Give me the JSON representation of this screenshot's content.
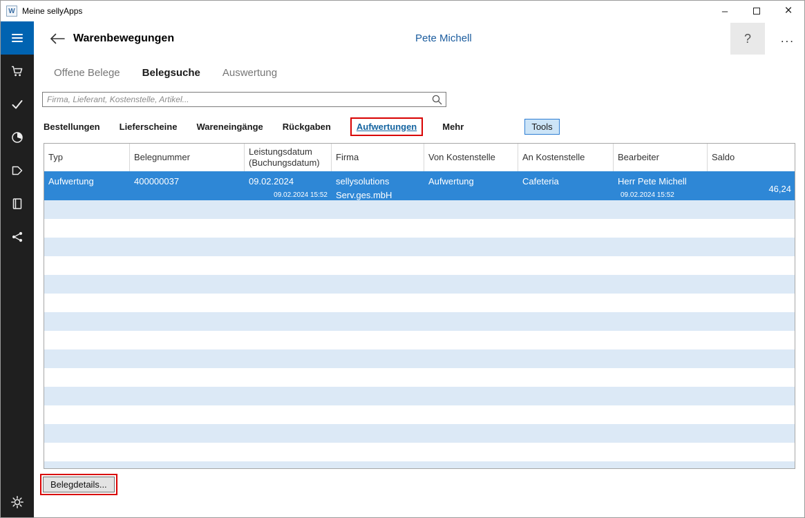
{
  "titlebar": {
    "app_icon_letter": "W",
    "title": "Meine sellyApps",
    "minimize_label": "–",
    "close_label": "×"
  },
  "sidebar": {
    "icons": [
      "menu",
      "cart",
      "checkmark",
      "pie-chart",
      "tag",
      "book",
      "share",
      "gear"
    ]
  },
  "header": {
    "title": "Warenbewegungen",
    "user": "Pete Michell",
    "help_label": "?",
    "more_label": "..."
  },
  "view_tabs": {
    "items": [
      "Offene Belege",
      "Belegsuche",
      "Auswertung"
    ],
    "active": "Belegsuche"
  },
  "search": {
    "placeholder": "Firma, Lieferant, Kostenstelle, Artikel..."
  },
  "filters": {
    "items": [
      "Bestellungen",
      "Lieferscheine",
      "Wareneingänge",
      "Rückgaben",
      "Aufwertungen",
      "Mehr"
    ],
    "active": "Aufwertungen",
    "tools_label": "Tools"
  },
  "table": {
    "columns": [
      "Typ",
      "Belegnummer",
      "Leistungsdatum (Buchungsdatum)",
      "Firma",
      "Von Kostenstelle",
      "An Kostenstelle",
      "Bearbeiter",
      "Saldo"
    ],
    "rows": [
      {
        "typ": "Aufwertung",
        "belegnummer": "400000037",
        "leistungsdatum": "09.02.2024",
        "buchungsdatum": "09.02.2024 15:52",
        "firma": "sellysolutions Serv.ges.mbH",
        "von_kostenstelle": "Aufwertung",
        "an_kostenstelle": "Cafeteria",
        "bearbeiter": "Herr Pete Michell",
        "bearbeiter_datum": "09.02.2024 15:52",
        "saldo": "46,24"
      }
    ]
  },
  "footer": {
    "belegdetails_label": "Belegdetails..."
  },
  "colors": {
    "accent": "#0063b1",
    "selected_row": "#2e87d6",
    "stripe": "#dce9f6",
    "annotation": "#d80000",
    "link_blue": "#1464a0"
  }
}
